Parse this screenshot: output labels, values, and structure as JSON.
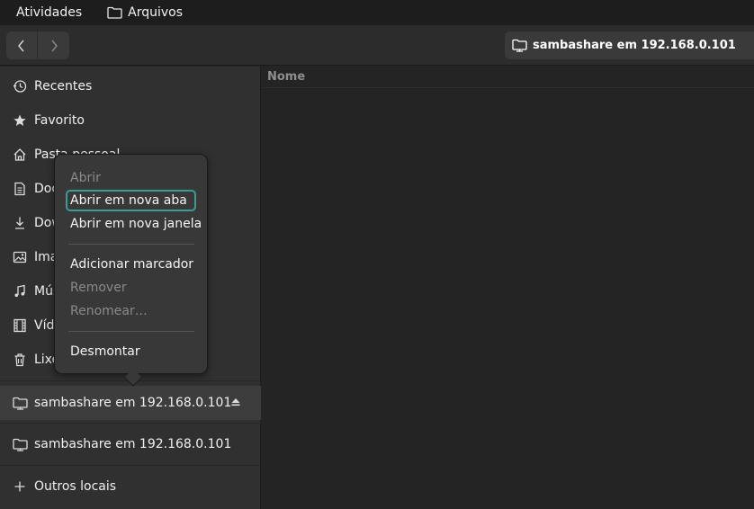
{
  "topbar": {
    "activities": "Atividades",
    "app_name": "Arquivos"
  },
  "headerbar": {
    "path": "sambashare em 192.168.0.101"
  },
  "main": {
    "column_name": "Nome"
  },
  "sidebar": {
    "items": [
      {
        "label": "Recentes",
        "icon": "clock-icon"
      },
      {
        "label": "Favorito",
        "icon": "star-icon"
      },
      {
        "label": "Pasta pessoal",
        "icon": "home-icon"
      },
      {
        "label": "Documentos",
        "icon": "document-icon"
      },
      {
        "label": "Downloads",
        "icon": "download-icon"
      },
      {
        "label": "Imagens",
        "icon": "image-icon"
      },
      {
        "label": "Músicas",
        "icon": "music-icon"
      },
      {
        "label": "Vídeos",
        "icon": "video-icon"
      },
      {
        "label": "Lixeira",
        "icon": "trash-icon"
      },
      {
        "label": "sambashare em 192.168.0.101",
        "icon": "network-folder-icon"
      },
      {
        "label": "sambashare em 192.168.0.101",
        "icon": "network-folder-icon"
      },
      {
        "label": "Outros locais",
        "icon": "plus-icon"
      }
    ]
  },
  "context_menu": {
    "items": [
      {
        "label": "Abrir",
        "enabled": false
      },
      {
        "label": "Abrir em nova aba",
        "enabled": true
      },
      {
        "label": "Abrir em nova janela",
        "enabled": true
      },
      {
        "label": "Adicionar marcador",
        "enabled": true
      },
      {
        "label": "Remover",
        "enabled": false
      },
      {
        "label": "Renomear…",
        "enabled": false
      },
      {
        "label": "Desmontar",
        "enabled": true
      }
    ]
  },
  "colors": {
    "focus_ring": "#3b9c94",
    "sidebar_bg": "#303030",
    "content_bg": "#242424"
  }
}
